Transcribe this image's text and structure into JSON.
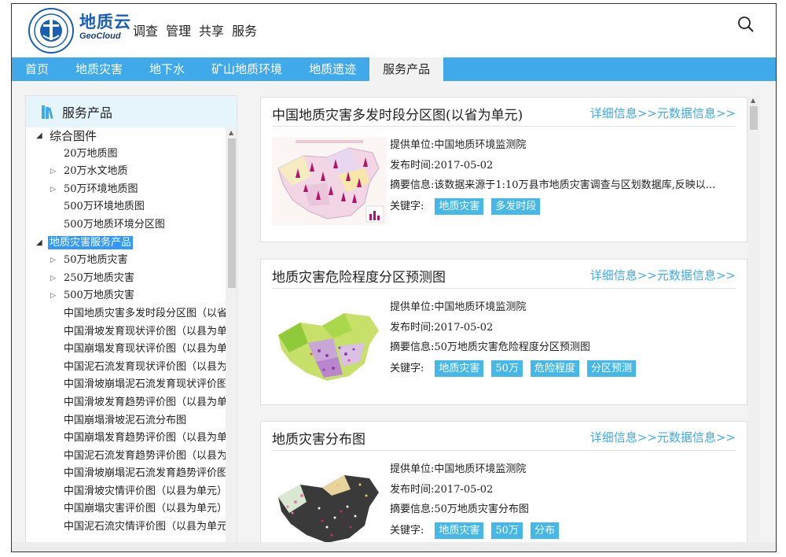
{
  "header": {
    "brand_cn": "地质云",
    "brand_en": "GeoCloud",
    "top_nav": [
      "调查",
      "管理",
      "共享",
      "服务"
    ]
  },
  "navbar": {
    "items": [
      "首页",
      "地质灾害",
      "地下水",
      "矿山地质环境",
      "地质遗迹",
      "服务产品"
    ],
    "active": "服务产品"
  },
  "sidebar": {
    "title": "服务产品",
    "tree": [
      {
        "label": "综合图件",
        "level": 0,
        "arrow": "◢"
      },
      {
        "label": "20万地质图",
        "level": 1,
        "arrow": ""
      },
      {
        "label": "20万水文地质",
        "level": 1,
        "arrow": "▷"
      },
      {
        "label": "50万环境地质图",
        "level": 1,
        "arrow": "▷"
      },
      {
        "label": "500万环境地质图",
        "level": 1,
        "arrow": ""
      },
      {
        "label": "500万地质环境分区图",
        "level": 1,
        "arrow": ""
      },
      {
        "label": "地质灾害服务产品",
        "level": 0,
        "arrow": "◢",
        "selected": true
      },
      {
        "label": "50万地质灾害",
        "level": 1,
        "arrow": "▷"
      },
      {
        "label": "250万地质灾害",
        "level": 1,
        "arrow": "▷"
      },
      {
        "label": "500万地质灾害",
        "level": 1,
        "arrow": "▷"
      },
      {
        "label": "中国地质灾害多发时段分区图（以省",
        "level": 2,
        "arrow": ""
      },
      {
        "label": "中国滑坡发育现状评价图（以县为单",
        "level": 2,
        "arrow": ""
      },
      {
        "label": "中国崩塌发育现状评价图（以县为单",
        "level": 2,
        "arrow": ""
      },
      {
        "label": "中国泥石流发育现状评价图（以县为",
        "level": 2,
        "arrow": ""
      },
      {
        "label": "中国滑坡崩塌泥石流发育现状评价图",
        "level": 2,
        "arrow": ""
      },
      {
        "label": "中国滑坡发育趋势评价图（以县为单",
        "level": 2,
        "arrow": ""
      },
      {
        "label": "中国崩塌滑坡泥石流分布图",
        "level": 2,
        "arrow": ""
      },
      {
        "label": "中国崩塌发育趋势评价图（以县为单",
        "level": 2,
        "arrow": ""
      },
      {
        "label": "中国泥石流发育趋势评价图（以县为",
        "level": 2,
        "arrow": ""
      },
      {
        "label": "中国滑坡崩塌泥石流发育趋势评价图",
        "level": 2,
        "arrow": ""
      },
      {
        "label": "中国滑坡灾情评价图（以县为单元）",
        "level": 2,
        "arrow": ""
      },
      {
        "label": "中国崩塌灾害评价图（以县为单元）",
        "level": 2,
        "arrow": ""
      },
      {
        "label": "中国泥石流灾情评价图（以县为单元",
        "level": 2,
        "arrow": ""
      }
    ]
  },
  "cards": [
    {
      "title": "中国地质灾害多发时段分区图(以省为单元)",
      "link_detail": "详细信息>>",
      "link_meta": "元数据信息>>",
      "provider": "提供单位:中国地质环境监测院",
      "date": "发布时间:2017-05-02",
      "summary": "摘要信息:该数据来源于1:10万县市地质灾害调查与区划数据库,反映以...",
      "kw_label": "关键字:",
      "tags": [
        "地质灾害",
        "多发时段"
      ],
      "thumb": "map-thumb-periods"
    },
    {
      "title": "地质灾害危险程度分区预测图",
      "link_detail": "详细信息>>",
      "link_meta": "元数据信息>>",
      "provider": "提供单位:中国地质环境监测院",
      "date": "发布时间:2017-05-02",
      "summary": "摘要信息:50万地质灾害危险程度分区预测图",
      "kw_label": "关键字:",
      "tags": [
        "地质灾害",
        "50万",
        "危险程度",
        "分区预测"
      ],
      "thumb": "map-thumb-risk"
    },
    {
      "title": "地质灾害分布图",
      "link_detail": "详细信息>>",
      "link_meta": "元数据信息>>",
      "provider": "提供单位:中国地质环境监测院",
      "date": "发布时间:2017-05-02",
      "summary": "摘要信息:50万地质灾害分布图",
      "kw_label": "关键字:",
      "tags": [
        "地质灾害",
        "50万",
        "分布"
      ],
      "thumb": "map-thumb-distribution"
    }
  ],
  "colors": {
    "nav_blue": "#3fa9e9",
    "tag_blue": "#45b8e8",
    "brand_blue": "#1a5fb4",
    "selection": "#3399ff"
  }
}
